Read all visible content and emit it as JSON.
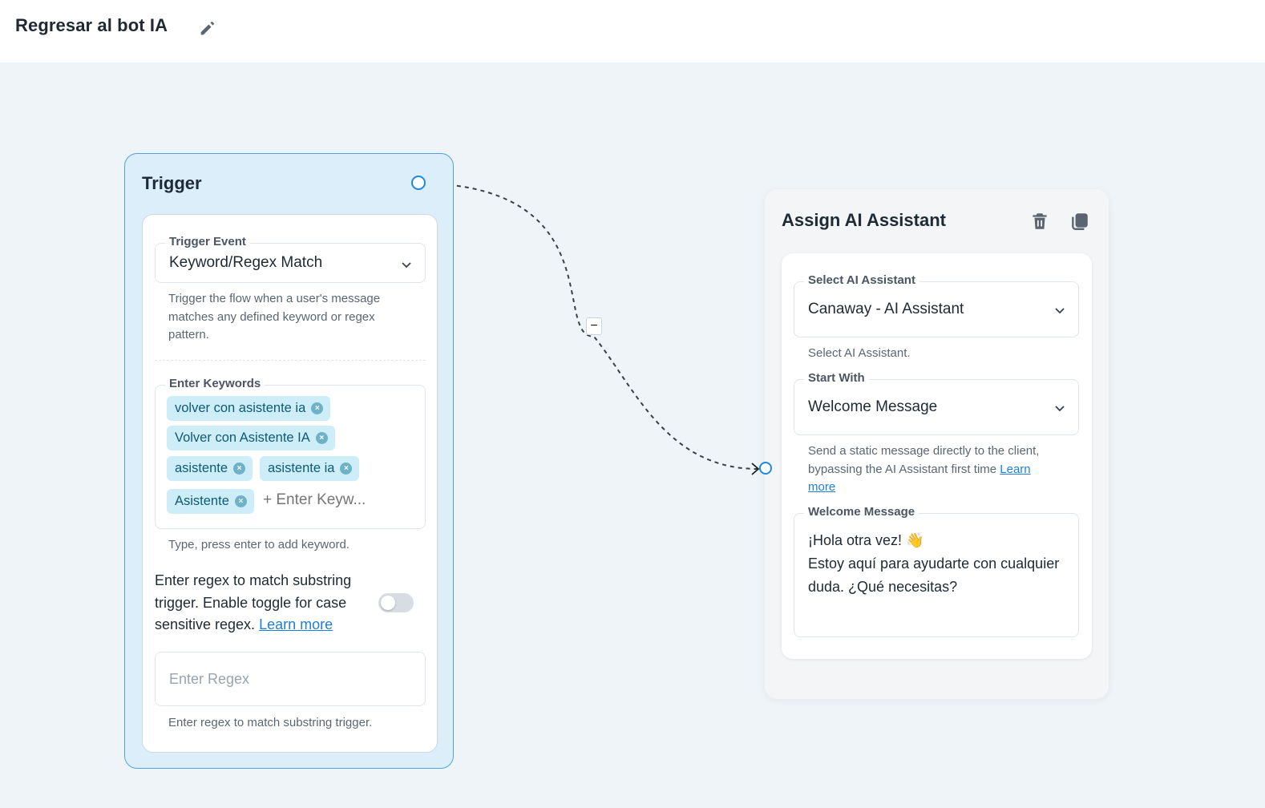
{
  "header": {
    "title": "Regresar al bot IA",
    "edit_icon": "pencil-icon"
  },
  "edge": {
    "handle_label": "−"
  },
  "trigger_node": {
    "title": "Trigger",
    "trigger_event": {
      "label": "Trigger Event",
      "value": "Keyword/Regex Match",
      "helper": "Trigger the flow when a user's message matches any defined keyword or regex pattern."
    },
    "keywords": {
      "label": "Enter Keywords",
      "chips": [
        "volver con asistente ia",
        "Volver con Asistente IA",
        "asistente",
        "asistente ia",
        "Asistente"
      ],
      "remove_icon": "×",
      "placeholder": "+ Enter Keyw...",
      "helper": "Type, press enter to add keyword."
    },
    "regex": {
      "description": "Enter regex to match substring trigger. Enable toggle for case sensitive regex.",
      "learn_more": "Learn more",
      "case_sensitive": false,
      "placeholder": "Enter Regex",
      "helper": "Enter regex to match substring trigger."
    }
  },
  "assign_node": {
    "title": "Assign AI Assistant",
    "delete_icon": "trash-icon",
    "duplicate_icon": "copy-icon",
    "select_assistant": {
      "label": "Select AI Assistant",
      "value": "Canaway - AI Assistant",
      "helper": "Select AI Assistant."
    },
    "start_with": {
      "label": "Start With",
      "value": "Welcome Message",
      "helper": "Send a static message directly to the client, bypassing the AI Assistant first time",
      "learn_more": "Learn more"
    },
    "welcome_message": {
      "label": "Welcome Message",
      "value": "¡Hola otra vez! 👋\nEstoy aquí para ayudarte con cualquier duda. ¿Qué necesitas?"
    }
  },
  "colors": {
    "canvas": "#eff4f8",
    "trigger_bg": "#dceefa",
    "trigger_border": "#4da3e8",
    "accent": "#1e88e5",
    "chip_bg": "#cdeef8",
    "link": "#1e7fd6"
  }
}
